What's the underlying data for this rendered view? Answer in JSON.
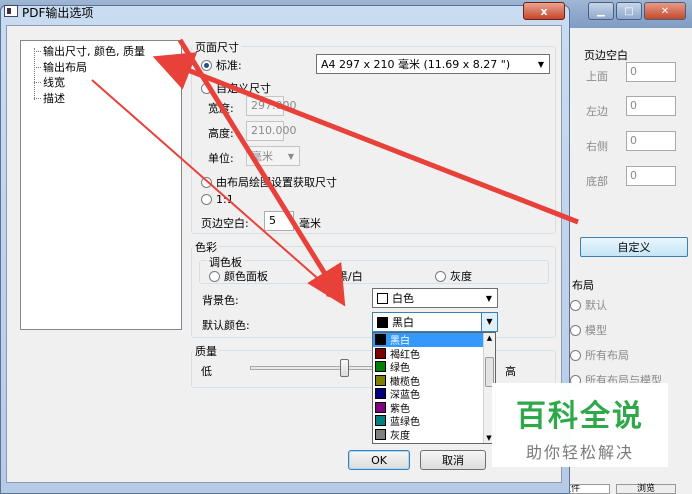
{
  "background": {
    "margin_group_title": "页边空白",
    "margin_fields": [
      {
        "label": "上面",
        "value": "0"
      },
      {
        "label": "左边",
        "value": "0"
      },
      {
        "label": "右侧",
        "value": "0"
      },
      {
        "label": "底部",
        "value": "0"
      }
    ],
    "custom_button": "自定义",
    "layout_group_title": "布局",
    "layout_options": [
      "默认",
      "模型",
      "所有布局",
      "所有布局与模型"
    ],
    "path_value": "C:\\Users\\Administrator\\Desktop\\图片\\图纸\\新建文件",
    "browse_button": "浏览"
  },
  "dialog": {
    "title": "PDF输出选项",
    "close_label": "x",
    "tree": [
      "输出尺寸, 颜色, 质量",
      "输出布局",
      "线宽",
      "描述"
    ],
    "page_size": {
      "group_title": "页面尺寸",
      "standard_label": "标准:",
      "standard_value": "A4 297 x 210 毫米 (11.69 x 8.27 \")",
      "custom_label": "自定义尺寸",
      "width_label": "宽度:",
      "width_value": "297.000",
      "height_label": "高度:",
      "height_value": "210.000",
      "unit_label": "单位:",
      "unit_value": "毫米",
      "from_layout_label": "由布局绘图设置获取尺寸",
      "scale_label": "1:1",
      "margin_label": "页边空白:",
      "margin_value": "5",
      "margin_unit": "毫米"
    },
    "color": {
      "group_title": "色彩",
      "palette_title": "调色板",
      "palette_options": [
        "颜色面板",
        "黑/白",
        "灰度"
      ],
      "bg_label": "背景色:",
      "bg_value": "白色",
      "default_label": "默认颜色:",
      "default_value": "黑白",
      "dropdown_items": [
        {
          "label": "黑白",
          "color": "#000000"
        },
        {
          "label": "褐红色",
          "color": "#800000"
        },
        {
          "label": "绿色",
          "color": "#008000"
        },
        {
          "label": "橄榄色",
          "color": "#808000"
        },
        {
          "label": "深蓝色",
          "color": "#000080"
        },
        {
          "label": "紫色",
          "color": "#800080"
        },
        {
          "label": "蓝绿色",
          "color": "#008080"
        },
        {
          "label": "灰度",
          "color": "#808080"
        }
      ]
    },
    "quality": {
      "group_title": "质量",
      "low_label": "低",
      "high_label": "高"
    },
    "ok_button": "OK",
    "cancel_button": "取消"
  },
  "watermark": {
    "title": "百科全说",
    "subtitle": "助你轻松解决"
  },
  "colors": {
    "annotation_arrow": "#e8413a",
    "selection": "#3399ff",
    "watermark_green": "#2fa84a"
  }
}
